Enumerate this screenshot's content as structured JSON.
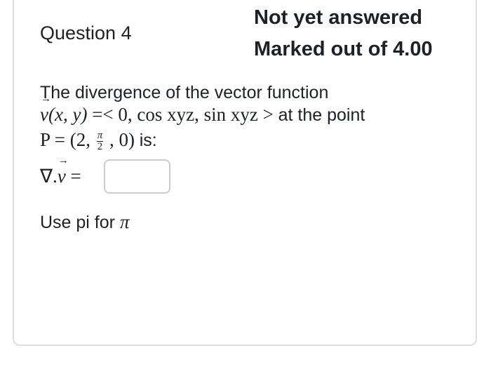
{
  "question": {
    "number_label": "Question 4",
    "state": "Not yet answered",
    "grade": "Marked out of 4.00"
  },
  "prompt": {
    "line1": "The divergence of the vector function",
    "line2": {
      "vector_symbol": "v",
      "args": "(x, y)",
      "equals": "=<",
      "components": "0, cos xyz, sin xyz",
      "close": ">",
      "suffix": "at the point"
    },
    "line3": {
      "point_prefix": "P = (2,",
      "frac_numerator": "π",
      "frac_denominator": "2",
      "point_suffix": ", 0)",
      "suffix": "is:"
    },
    "answer_label": {
      "nabla": "∇.",
      "vector_symbol": "v",
      "equals": "="
    }
  },
  "answer": {
    "value": "",
    "placeholder": ""
  },
  "hint": {
    "prefix": "Use pi for",
    "symbol": "π"
  }
}
